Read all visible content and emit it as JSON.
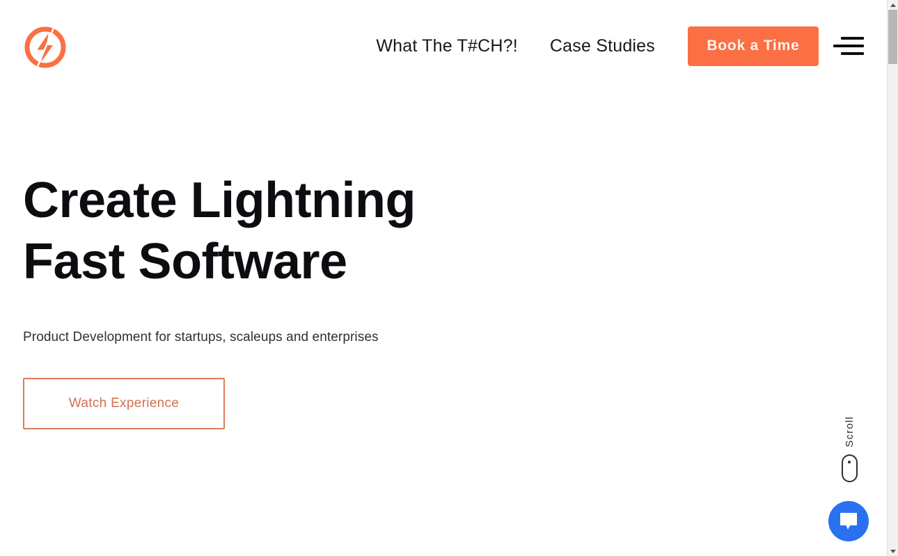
{
  "header": {
    "logo_alt": "lightning-bolt-logo",
    "nav": [
      {
        "label": "What The T#CH?!"
      },
      {
        "label": "Case Studies"
      }
    ],
    "cta_label": "Book a Time",
    "menu_icon": "hamburger-menu-icon"
  },
  "hero": {
    "title_line1": "Create Lightning",
    "title_line2": "Fast Software",
    "subtitle": "Product Development for startups, scaleups and enterprises",
    "watch_label": "Watch Experience"
  },
  "scroll": {
    "label": "Scroll",
    "icon": "mouse-scroll-icon"
  },
  "chat": {
    "icon": "chat-bubble-icon"
  },
  "scrollbar": {
    "up_icon": "scroll-up-arrow-icon",
    "down_icon": "scroll-down-arrow-icon"
  },
  "colors": {
    "brand_orange": "#fa6f43",
    "outline_orange": "#dd7b5b",
    "outline_text": "#d2714f",
    "text_dark": "#16181d",
    "chat_blue": "#2a71f0"
  }
}
